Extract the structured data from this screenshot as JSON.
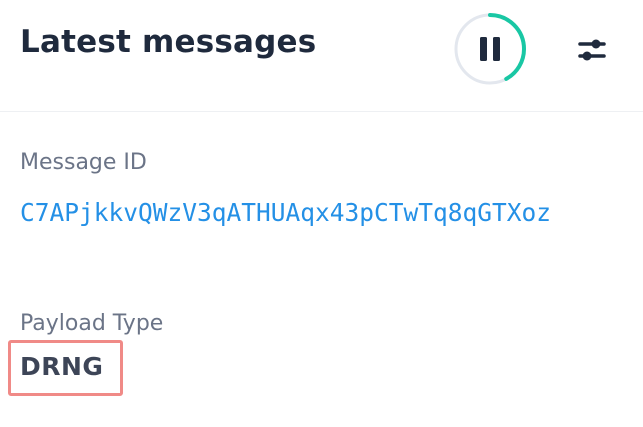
{
  "header": {
    "title": "Latest messages",
    "pause_progress": 0.42,
    "accent_color": "#19c7a4"
  },
  "message": {
    "id_label": "Message ID",
    "id_value": "C7APjkkvQWzV3qATHUAqx43pCTwTq8qGTXoz",
    "payload_label": "Payload Type",
    "payload_value": "DRNG"
  },
  "icons": {
    "pause": "pause-icon",
    "settings": "sliders-icon"
  },
  "colors": {
    "link": "#2490e6",
    "highlight": "#f08a87"
  }
}
